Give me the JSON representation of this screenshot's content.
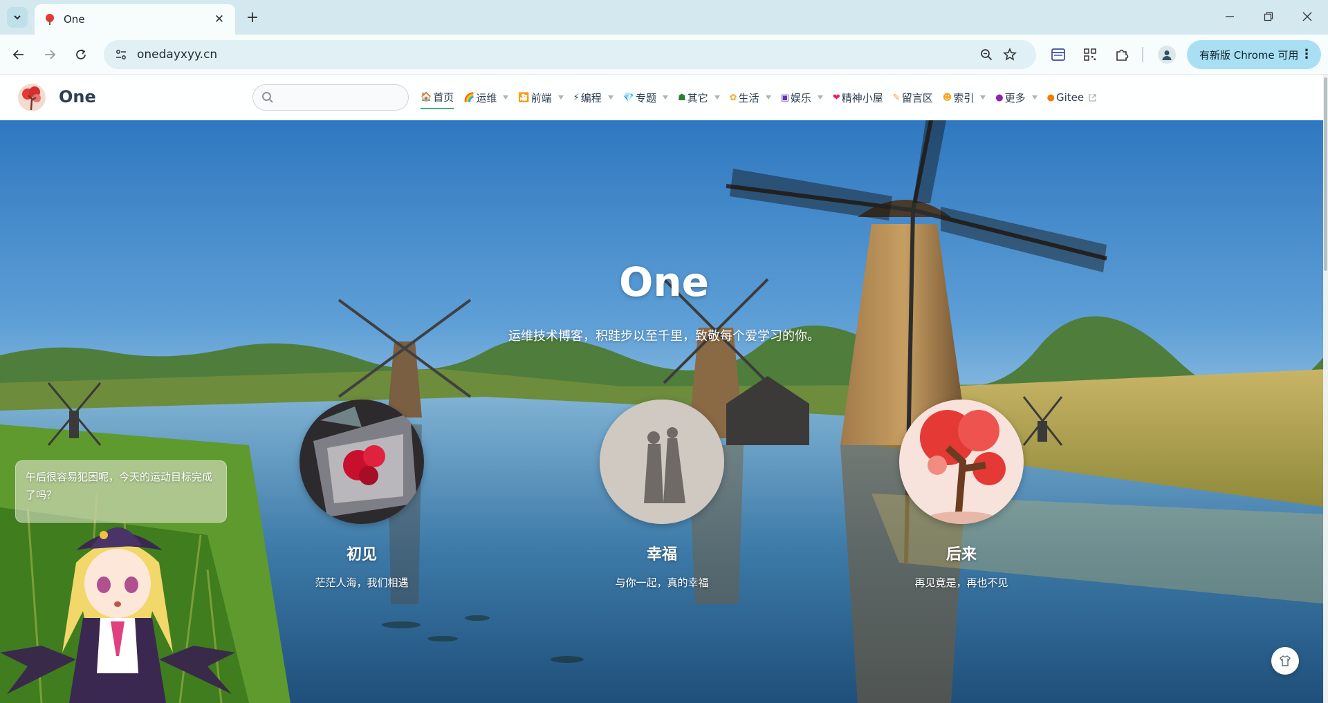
{
  "browser": {
    "tab_title": "One",
    "url": "onedayxyy.cn",
    "update_label": "有新版 Chrome 可用",
    "update_menu": "⋮"
  },
  "site": {
    "name": "One",
    "search_placeholder": ""
  },
  "nav": [
    {
      "emoji": "🏠",
      "label": "首页",
      "active": true,
      "dropdown": false
    },
    {
      "emoji": "🌈",
      "label": "运维",
      "active": false,
      "dropdown": true
    },
    {
      "emoji": "🎦",
      "label": "前端",
      "active": false,
      "dropdown": true
    },
    {
      "emoji": "⚡",
      "label": "编程",
      "active": false,
      "dropdown": true
    },
    {
      "emoji": "💎",
      "label": "专题",
      "active": false,
      "dropdown": true
    },
    {
      "emoji": "☗",
      "label": "其它",
      "active": false,
      "dropdown": true
    },
    {
      "emoji": "✿",
      "label": "生活",
      "active": false,
      "dropdown": true
    },
    {
      "emoji": "▣",
      "label": "娱乐",
      "active": false,
      "dropdown": true
    },
    {
      "emoji": "❤",
      "label": "精神小屋",
      "active": false,
      "dropdown": false
    },
    {
      "emoji": "✎",
      "label": "留言区",
      "active": false,
      "dropdown": false
    },
    {
      "emoji": "☻",
      "label": "索引",
      "active": false,
      "dropdown": true
    },
    {
      "emoji": "●",
      "label": "更多",
      "active": false,
      "dropdown": true
    },
    {
      "emoji": "●",
      "label": "Gitee",
      "active": false,
      "dropdown": false,
      "external": true
    }
  ],
  "hero": {
    "title": "One",
    "subtitle": "运维技术博客，积跬步以至千里，致敬每个爱学习的你。"
  },
  "features": [
    {
      "title": "初见",
      "desc": "茫茫人海，我们相遇"
    },
    {
      "title": "幸福",
      "desc": "与你一起，真的幸福"
    },
    {
      "title": "后来",
      "desc": "再见竟是，再也不见"
    }
  ],
  "mascot": {
    "bubble_text": "午后很容易犯困呢，今天的运动目标完成了吗？"
  },
  "colors": {
    "accent": "#3eaf7c",
    "tab_bar": "#d3e9ef",
    "update_chip": "#a9dff2"
  }
}
